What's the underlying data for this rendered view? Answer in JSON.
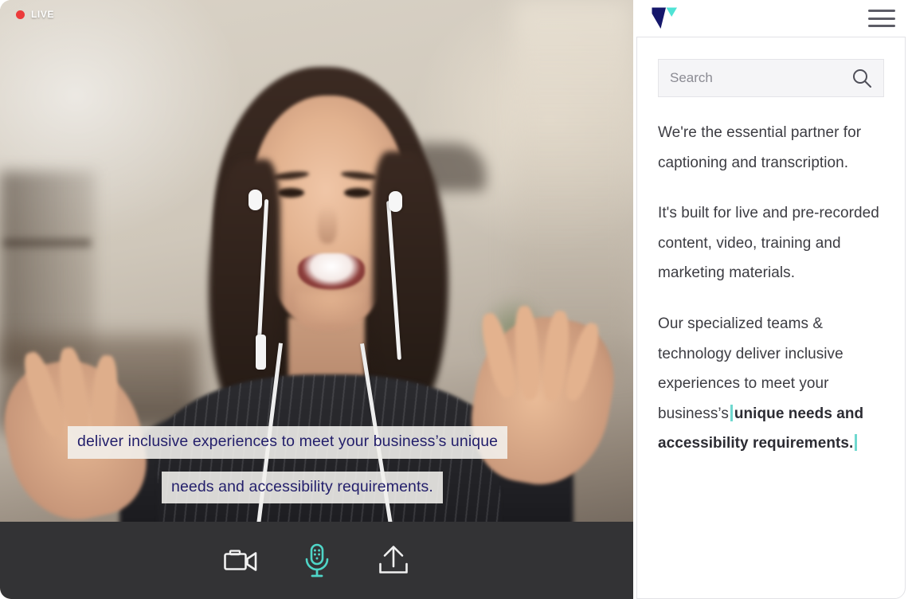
{
  "video": {
    "live_badge": {
      "label": "LIVE",
      "dot_color": "#ec3b3b",
      "icon": "record-dot-icon"
    },
    "captions": [
      "deliver inclusive experiences to meet your business’s unique",
      "needs and accessibility requirements."
    ],
    "caption_text_color": "#231f6b",
    "caption_background": "rgba(243,241,238,0.88)"
  },
  "controls": {
    "background": "#333335",
    "buttons": [
      {
        "name": "camera-button",
        "icon": "video-camera-icon",
        "label": "Camera",
        "active": false,
        "color": "#f0f0f0"
      },
      {
        "name": "microphone-button",
        "icon": "microphone-icon",
        "label": "Microphone",
        "active": true,
        "color": "#4fd5c7"
      },
      {
        "name": "share-button",
        "icon": "upload-icon",
        "label": "Upload",
        "active": false,
        "color": "#f0f0f0"
      }
    ]
  },
  "panel": {
    "logo": {
      "icon": "verbit-v-logo",
      "primary_color": "#15176b",
      "accent_color": "#4fe3d5"
    },
    "menu": {
      "icon": "hamburger-menu-icon",
      "label": "Menu",
      "color": "#5c5c66"
    },
    "search": {
      "placeholder": "Search",
      "value": "",
      "icon": "search-icon"
    },
    "transcript": {
      "paragraphs": [
        {
          "text": "We're the essential partner for captioning and transcription.",
          "bold": false
        },
        {
          "text": "It's built for live and pre-recorded content, video, training and marketing materials.",
          "bold": false
        }
      ],
      "active_paragraph": {
        "plain_prefix": "Our specialized teams & technology deliver inclusive experiences to meet your business’s",
        "highlight": "unique needs and accessibility requirements.",
        "cursor_color": "#6fd8cf"
      }
    }
  }
}
